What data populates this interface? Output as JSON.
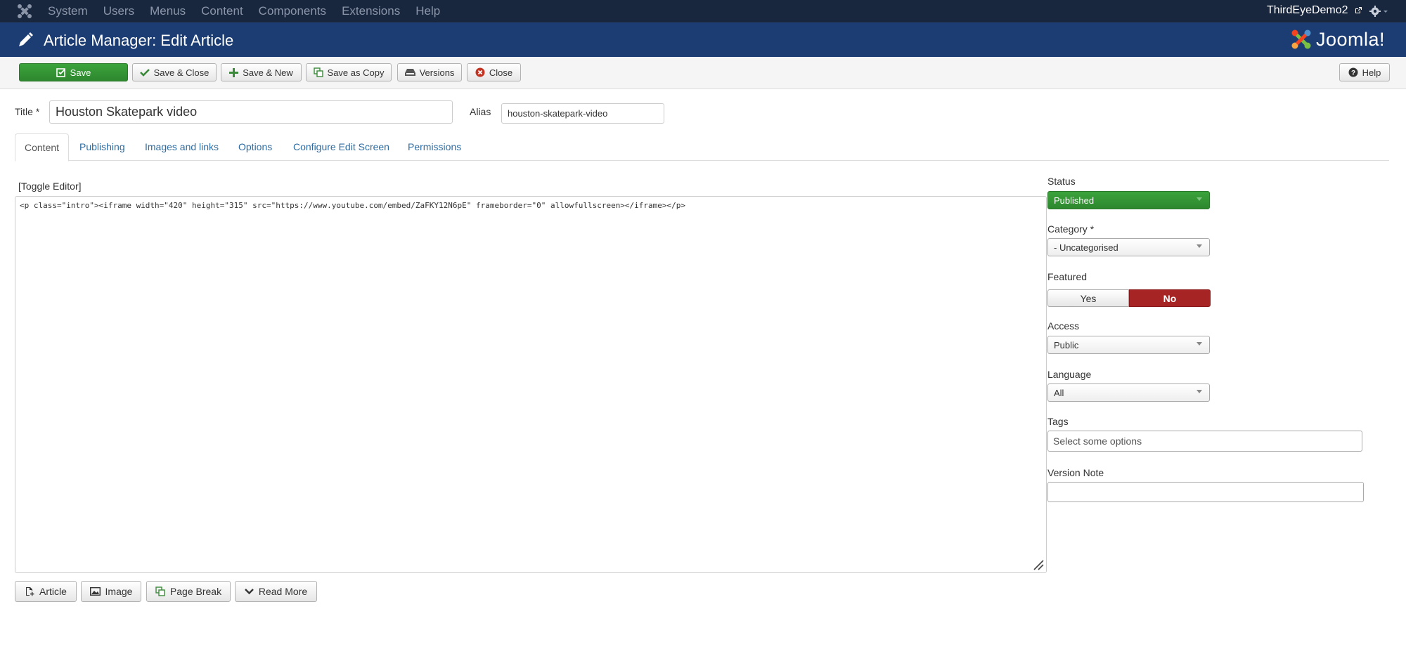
{
  "nav": {
    "items": [
      "System",
      "Users",
      "Menus",
      "Content",
      "Components",
      "Extensions",
      "Help"
    ],
    "user": "ThirdEyeDemo2"
  },
  "header": {
    "title": "Article Manager: Edit Article",
    "brand": "Joomla!"
  },
  "toolbar": {
    "save": "Save",
    "save_close": "Save & Close",
    "save_new": "Save & New",
    "save_copy": "Save as Copy",
    "versions": "Versions",
    "close": "Close",
    "help": "Help"
  },
  "form": {
    "title_label": "Title *",
    "title_value": "Houston Skatepark video",
    "alias_label": "Alias",
    "alias_value": "houston-skatepark-video"
  },
  "tabs": [
    "Content",
    "Publishing",
    "Images and links",
    "Options",
    "Configure Edit Screen",
    "Permissions"
  ],
  "editor": {
    "toggle": "[Toggle Editor]",
    "content": "<p class=\"intro\"><iframe width=\"420\" height=\"315\" src=\"https://www.youtube.com/embed/ZaFKY12N6pE\" frameborder=\"0\" allowfullscreen></iframe></p>",
    "buttons": [
      "Article",
      "Image",
      "Page Break",
      "Read More"
    ]
  },
  "sidebar": {
    "status_label": "Status",
    "status_value": "Published",
    "category_label": "Category *",
    "category_value": "- Uncategorised",
    "featured_label": "Featured",
    "featured_yes": "Yes",
    "featured_no": "No",
    "featured_selected": "No",
    "access_label": "Access",
    "access_value": "Public",
    "language_label": "Language",
    "language_value": "All",
    "tags_label": "Tags",
    "tags_placeholder": "Select some options",
    "version_note_label": "Version Note",
    "version_note_value": ""
  },
  "colors": {
    "nav_bg": "#18263e",
    "header_bg": "#1c3d73",
    "success": "#2e872e",
    "danger": "#a72424",
    "link": "#2d6ca2"
  }
}
